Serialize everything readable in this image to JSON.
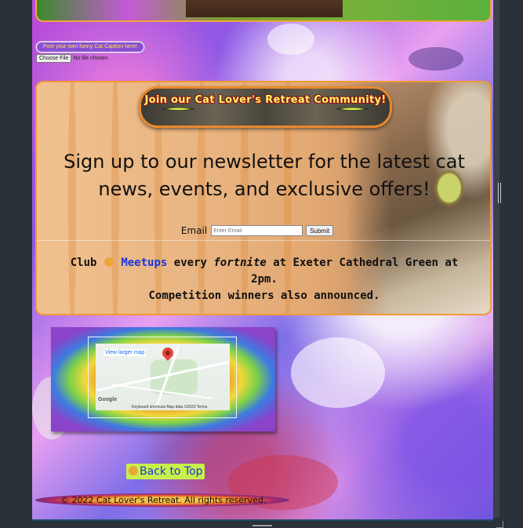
{
  "caption_upload": {
    "prompt": "Post your own funny Cat Caption here!",
    "choose_file_label": "Choose File",
    "file_status": "No file chosen"
  },
  "newsletter": {
    "banner_text": "Join our Cat Lover's Retreat Community!",
    "headline": "Sign up to our newsletter for the latest cat news, events, and exclusive offers!",
    "email_label": "Email",
    "email_placeholder": "Enter Email",
    "submit_label": "Submit"
  },
  "meetup": {
    "part1": "Club",
    "link_text": "Meetups",
    "part2": "every",
    "emphasis": "fortnite",
    "part3": "at Exeter Cathedral Green at 2pm.",
    "line2": "Competition winners also announced."
  },
  "map": {
    "view_larger": "View larger map",
    "google": "Google",
    "footer": "Keyboard shortcuts    Map data ©2023    Terms"
  },
  "back_to_top": {
    "label": "Back to Top"
  },
  "footer": {
    "copyright": "© 2022 Cat Lover's Retreat. All rights reserved."
  },
  "colors": {
    "link": "#1a35e0",
    "panel_border": "#f19a36",
    "back_to_top_bg": "#c8f04a",
    "banner_text": "#fff36a"
  },
  "icons": [
    "paw-icon",
    "map-pin-icon"
  ]
}
